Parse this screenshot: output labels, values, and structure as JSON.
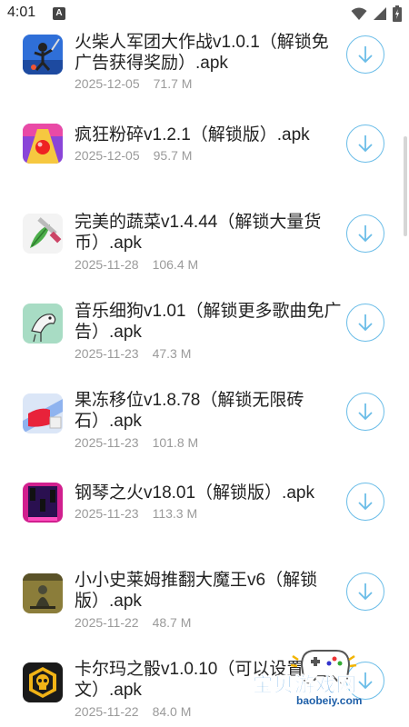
{
  "status_bar": {
    "time": "4:01",
    "notification_icon": "A",
    "icons": [
      "wifi-icon",
      "signal-icon",
      "battery-icon"
    ]
  },
  "accent_color": "#6bbde8",
  "items": [
    {
      "title": "火柴人军团大作战v1.0.1（解锁免广告获得奖励）.apk",
      "date": "2025-12-05",
      "size": "71.7 M",
      "icon": "stickman-icon"
    },
    {
      "title": "疯狂粉碎v1.2.1（解锁版）.apk",
      "date": "2025-12-05",
      "size": "95.7 M",
      "icon": "ball-icon"
    },
    {
      "title": "完美的蔬菜v1.4.44（解锁大量货币）.apk",
      "date": "2025-11-28",
      "size": "106.4 M",
      "icon": "vegetable-icon"
    },
    {
      "title": "音乐细狗v1.01（解锁更多歌曲免广告）.apk",
      "date": "2025-11-23",
      "size": "47.3 M",
      "icon": "dog-icon"
    },
    {
      "title": "果冻移位v1.8.78（解锁无限砖石）.apk",
      "date": "2025-11-23",
      "size": "101.8 M",
      "icon": "jelly-icon"
    },
    {
      "title": "钢琴之火v18.01（解锁版）.apk",
      "date": "2025-11-23",
      "size": "113.3 M",
      "icon": "piano-icon"
    },
    {
      "title": "小小史莱姆推翻大魔王v6（解锁版）.apk",
      "date": "2025-11-22",
      "size": "48.7 M",
      "icon": "slime-icon"
    },
    {
      "title": "卡尔玛之骰v1.0.10（可以设置中文）.apk",
      "date": "2025-11-22",
      "size": "84.0 M",
      "icon": "skull-icon"
    }
  ],
  "watermark": {
    "name": "宝贝游戏网",
    "url": "baobeiy.com"
  }
}
